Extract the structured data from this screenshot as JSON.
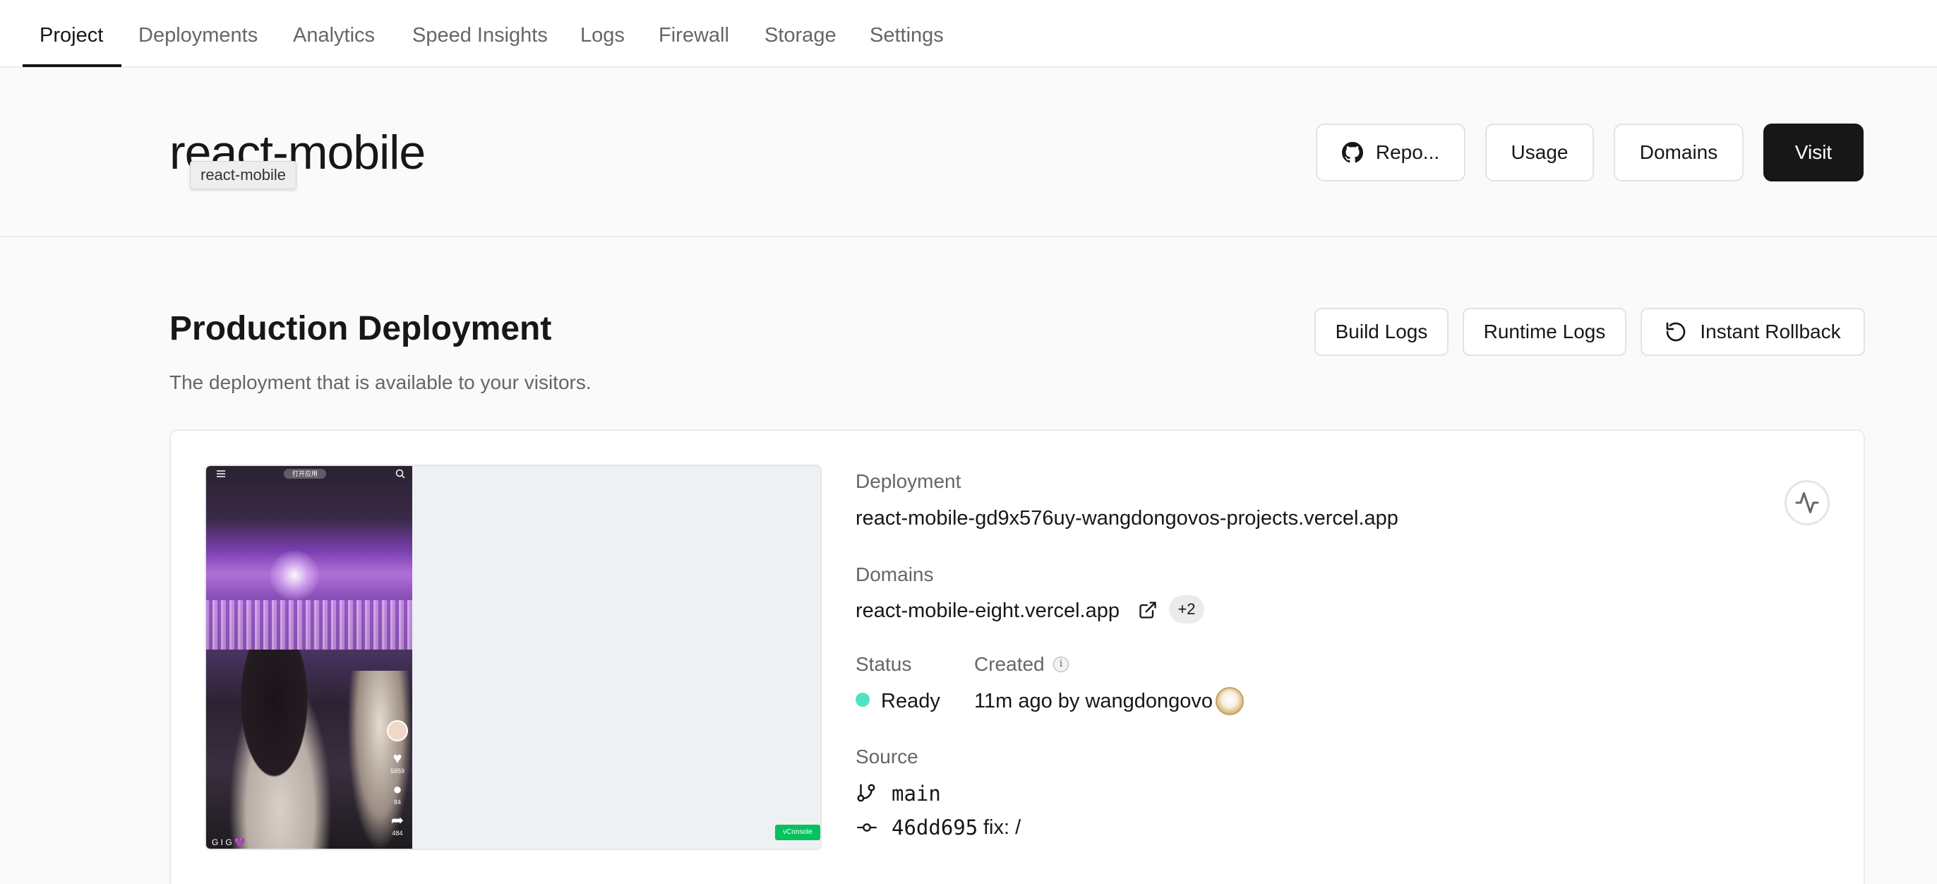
{
  "nav": {
    "tabs": [
      {
        "label": "Project",
        "active": true
      },
      {
        "label": "Deployments"
      },
      {
        "label": "Analytics"
      },
      {
        "label": "Speed Insights"
      },
      {
        "label": "Logs"
      },
      {
        "label": "Firewall"
      },
      {
        "label": "Storage"
      },
      {
        "label": "Settings"
      }
    ]
  },
  "header": {
    "project_name": "react-mobile",
    "tooltip": "react-mobile",
    "buttons": {
      "repo": "Repo...",
      "usage": "Usage",
      "domains": "Domains",
      "visit": "Visit"
    }
  },
  "production": {
    "title": "Production Deployment",
    "subtitle": "The deployment that is available to your visitors.",
    "buttons": {
      "build_logs": "Build Logs",
      "runtime_logs": "Runtime Logs",
      "instant_rollback": "Instant Rollback"
    },
    "preview": {
      "pill_text": "打开应用",
      "counts": [
        "5859",
        "84",
        "484"
      ],
      "footer_text": "G I G 💜",
      "vconsole_label": "vConsole"
    },
    "deployment": {
      "label": "Deployment",
      "url": "react-mobile-gd9x576uy-wangdongovos-projects.vercel.app"
    },
    "domains": {
      "label": "Domains",
      "primary": "react-mobile-eight.vercel.app",
      "extra_count": "+2"
    },
    "status": {
      "label": "Status",
      "value": "Ready",
      "color": "#50e3c2"
    },
    "created": {
      "label": "Created",
      "value": "11m ago by wangdongovo",
      "info_glyph": "i"
    },
    "source": {
      "label": "Source",
      "branch": "main",
      "commit_hash": "46dd695",
      "commit_message": "fix: /"
    }
  },
  "colors": {
    "accent_dark": "#171717",
    "muted_text": "#666666",
    "border": "#ebebeb",
    "vconsole_green": "#07c160"
  }
}
